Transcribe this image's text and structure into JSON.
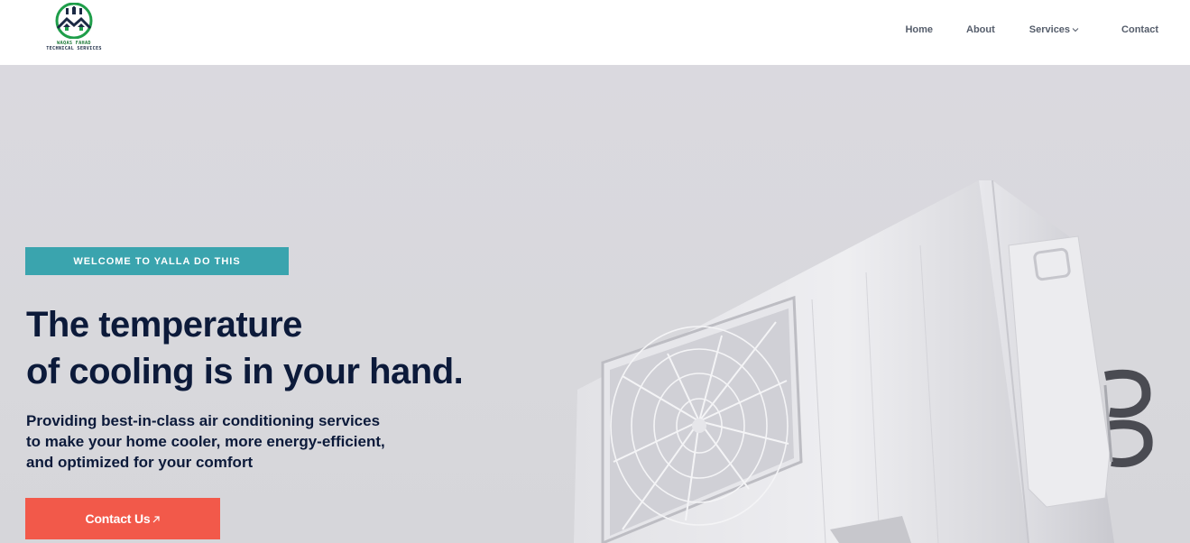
{
  "brand": {
    "name_line1": "WAQAS FAHAD",
    "name_line2": "TECHNICAL SERVICES",
    "colors": {
      "green": "#1f9e4a",
      "navy": "#1b2a44"
    }
  },
  "nav": {
    "items": [
      {
        "label": "Home"
      },
      {
        "label": "About"
      },
      {
        "label": "Services",
        "icon": "chevron-down-icon"
      },
      {
        "label": "Contact"
      }
    ]
  },
  "hero": {
    "badge": "WELCOME TO YALLA DO THIS",
    "headline": [
      "The temperature",
      "of cooling is in your hand."
    ],
    "subtext": [
      "Providing best-in-class air conditioning services",
      "to make your home cooler, more energy-efficient,",
      "and optimized for your comfort"
    ],
    "cta": {
      "label": "Contact Us",
      "icon": "arrow-up-right-icon"
    },
    "image": "air-conditioner-outdoor-unit"
  },
  "theme": {
    "badge_bg": "#3aa4ae",
    "cta_bg": "#f2594a",
    "heading_color": "#0c1a3a",
    "hero_bg": "#d9d9dd"
  }
}
